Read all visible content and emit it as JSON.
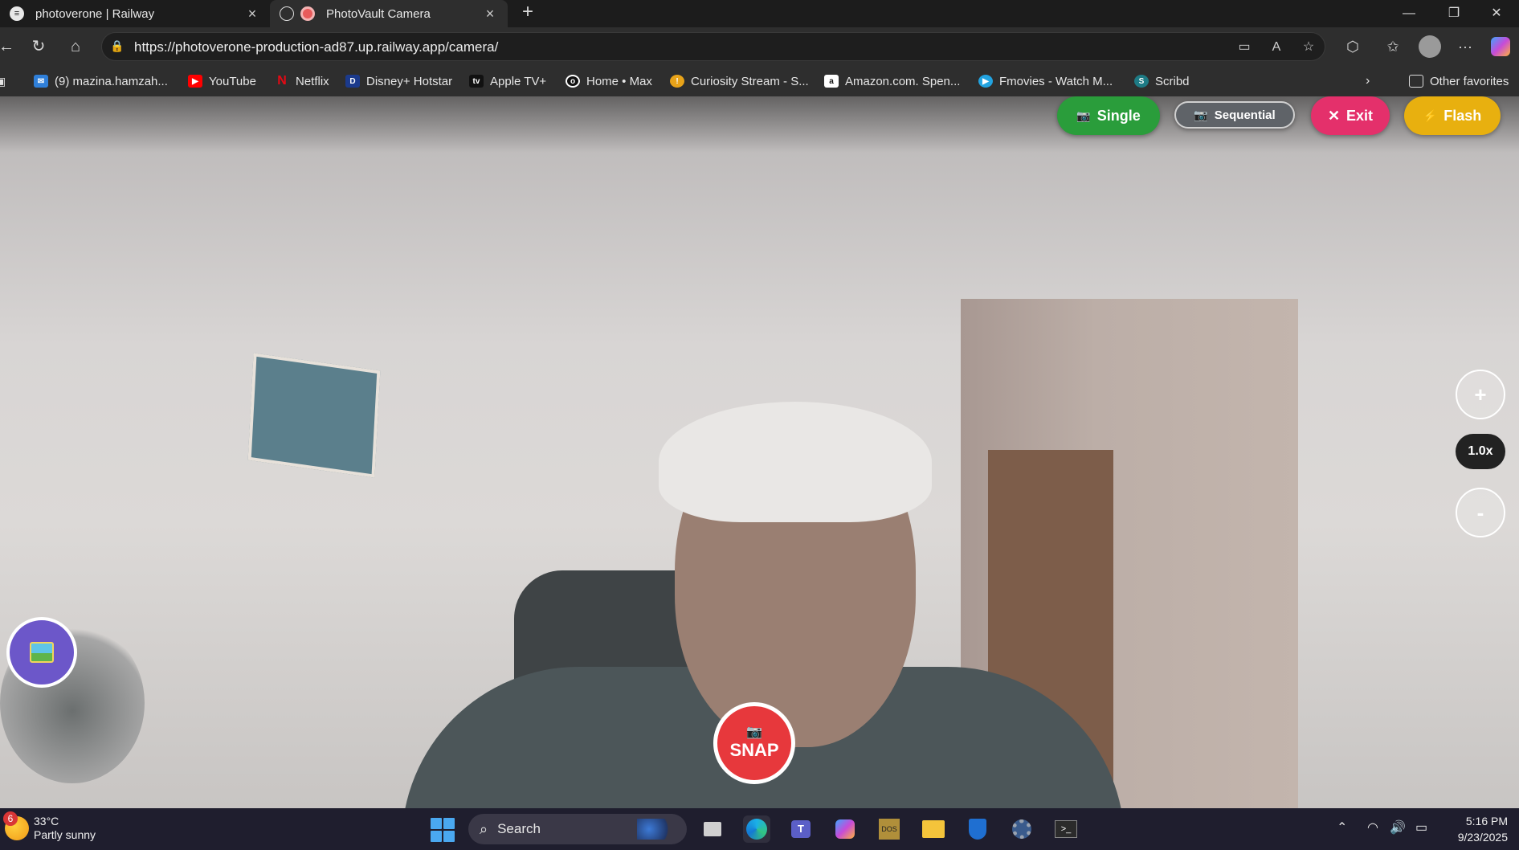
{
  "browser": {
    "tabs": [
      {
        "title": "photoverone | Railway",
        "active": false
      },
      {
        "title": "PhotoVault Camera",
        "active": true
      }
    ],
    "url": "https://photoverone-production-ad87.up.railway.app/camera/",
    "favorites": [
      {
        "label": "(9) mazina.hamzah...",
        "icon": "mail-icon",
        "color": "#2f7fd9"
      },
      {
        "label": "YouTube",
        "icon": "youtube-icon",
        "color": "#ff0000"
      },
      {
        "label": "Netflix",
        "icon": "netflix-icon",
        "color": "#e50914"
      },
      {
        "label": "Disney+ Hotstar",
        "icon": "hotstar-icon",
        "color": "#1b3a8c"
      },
      {
        "label": "Apple TV+",
        "icon": "appletv-icon",
        "color": "#111111"
      },
      {
        "label": "Home • Max",
        "icon": "max-icon",
        "color": "#111111"
      },
      {
        "label": "Curiosity Stream - S...",
        "icon": "curiosity-icon",
        "color": "#e8a319"
      },
      {
        "label": "Amazon.com. Spen...",
        "icon": "amazon-icon",
        "color": "#ffffff"
      },
      {
        "label": "Fmovies - Watch M...",
        "icon": "fmovies-icon",
        "color": "#22a3e0"
      },
      {
        "label": "Scribd",
        "icon": "scribd-icon",
        "color": "#1e7b85"
      }
    ],
    "other_favorites": "Other favorites"
  },
  "camera": {
    "modes": {
      "single": "Single",
      "sequential": "Sequential"
    },
    "exit": "Exit",
    "flash": "Flash",
    "zoom_in": "+",
    "zoom_level": "1.0x",
    "zoom_out": "-",
    "snap": "SNAP",
    "colors": {
      "single": "#2a9d3b",
      "exit": "#e4306b",
      "flash": "#e8b00f",
      "snap": "#e7383c",
      "gallery": "#6c57c9"
    }
  },
  "taskbar": {
    "weather_badge": "6",
    "temperature": "33°C",
    "condition": "Partly sunny",
    "search_placeholder": "Search",
    "time": "5:16 PM",
    "date": "9/23/2025"
  }
}
